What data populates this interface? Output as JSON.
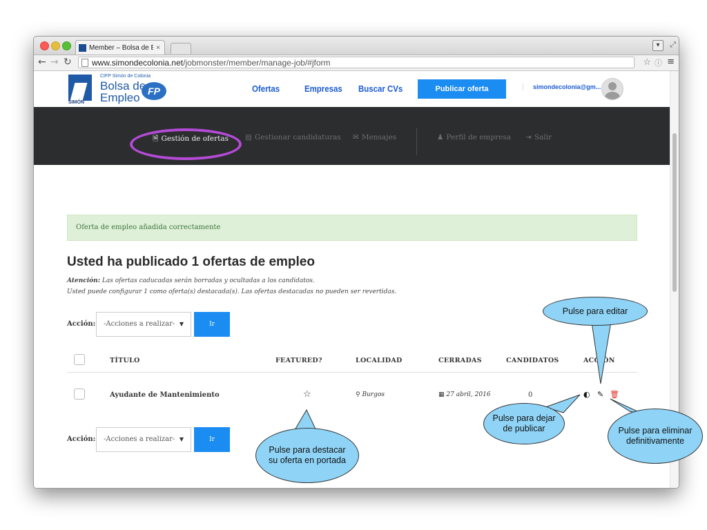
{
  "browser": {
    "tab_title": "Member – Bolsa de Empleo",
    "tab_close": "×",
    "url_host": "www.simondecolonia.net",
    "url_path": "/jobmonster/member/manage-job/#jform"
  },
  "header": {
    "logo_line1": "CIFP Simón de Colonia",
    "logo_line2": "Bolsa de",
    "logo_line3": "Empleo",
    "logo_side": "SIMÓN",
    "logo_fp": "FP",
    "nav": [
      "Ofertas",
      "Empresas",
      "Buscar CVs"
    ],
    "publish_label": "Publicar oferta",
    "account": "simondecolonia@gm..."
  },
  "subnav": {
    "items": [
      "Gestión de ofertas",
      "Gestionar candidaturas",
      "Mensajes",
      "Perfil de empresa",
      "Salir"
    ]
  },
  "alert": "Oferta de empleo añadida correctamente",
  "page_title": "Usted ha publicado 1 ofertas de empleo",
  "note": {
    "label": "Atención:",
    "line1": "Las ofertas caducadas serán borradas y ocultadas a los candidatos.",
    "line2": "Usted puede configurar 1 como oferta(s) destacada(s). Las ofertas destacadas no pueden ser revertidas."
  },
  "bulk_action": {
    "label": "Acción:",
    "select_value": "-Acciones a realizar-",
    "go_label": "Ir"
  },
  "table": {
    "headers": [
      "TÍTULO",
      "FEATURED?",
      "LOCALIDAD",
      "CERRADAS",
      "CANDIDATOS",
      "ACCIÓN"
    ],
    "rows": [
      {
        "title": "Ayudante de Mantenimiento",
        "location": "Burgos",
        "closing": "27 abril, 2016",
        "candidates": "0"
      }
    ]
  },
  "callouts": {
    "edit": "Pulse para editar",
    "unpublish": "Pulse para dejar de publicar",
    "delete": "Pulse para eliminar definitivamente",
    "feature": "Pulse para destacar su oferta en portada"
  },
  "colors": {
    "accent": "#1a8cf2",
    "link": "#1b5bd1",
    "dark_nav": "#2b2d2f",
    "highlight": "#b44bd6",
    "callout": "#8fd4f7",
    "alert_bg": "#dff0d8",
    "delete": "#e0322b"
  }
}
